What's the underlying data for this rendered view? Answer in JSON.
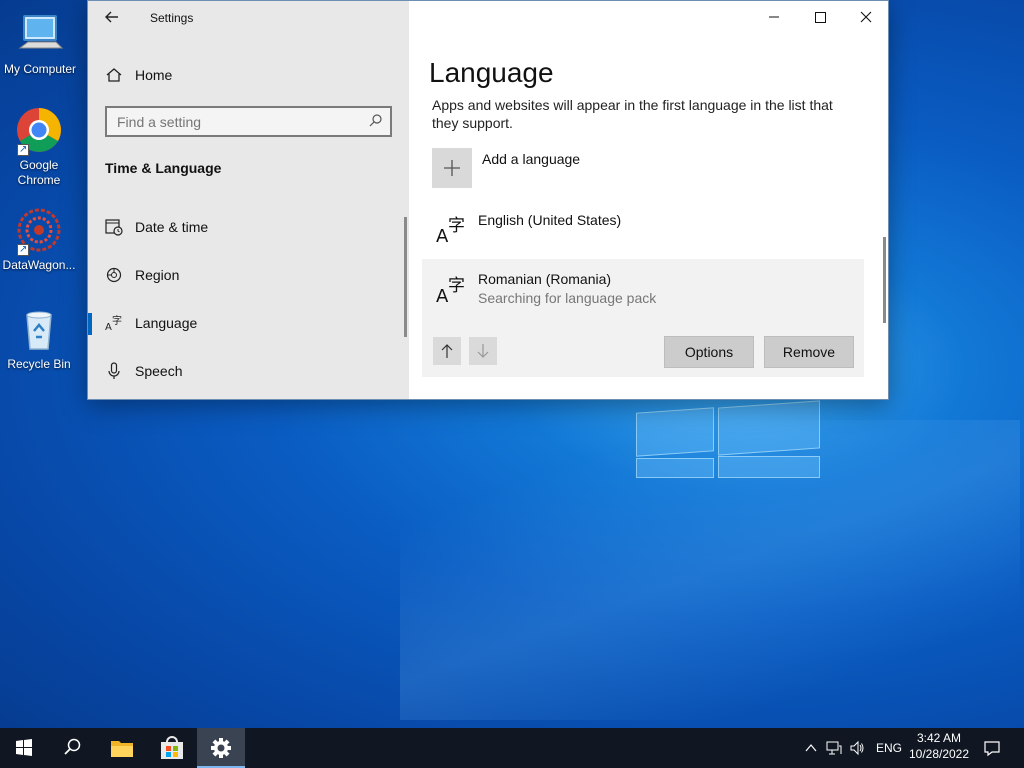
{
  "desktop": {
    "icons": [
      {
        "label": "My Computer",
        "icon": "computer-icon"
      },
      {
        "label": "Google Chrome",
        "icon": "chrome-icon"
      },
      {
        "label": "DataWagon...",
        "icon": "datawagon-icon"
      },
      {
        "label": "Recycle Bin",
        "icon": "recycle-bin-icon"
      }
    ]
  },
  "window": {
    "title": "Settings",
    "back_icon": "back-arrow-icon",
    "caption": {
      "minimize": "─",
      "maximize": "☐",
      "close": "✕"
    }
  },
  "sidebar": {
    "home_label": "Home",
    "search_placeholder": "Find a setting",
    "section_title": "Time & Language",
    "items": [
      {
        "label": "Date & time",
        "icon": "date-time-icon"
      },
      {
        "label": "Region",
        "icon": "globe-icon"
      },
      {
        "label": "Language",
        "icon": "language-icon",
        "active": true
      },
      {
        "label": "Speech",
        "icon": "microphone-icon"
      }
    ]
  },
  "main": {
    "title": "Language",
    "description": "Apps and websites will appear in the first language in the list that they support.",
    "add_label": "Add a language",
    "languages": [
      {
        "name": "English (United States)",
        "status": ""
      },
      {
        "name": "Romanian (Romania)",
        "status": "Searching for language pack",
        "selected": true
      }
    ],
    "options_label": "Options",
    "remove_label": "Remove"
  },
  "taskbar": {
    "apps": [
      "start-icon",
      "search-icon",
      "file-explorer-icon",
      "store-icon",
      "settings-icon"
    ],
    "active_app": "settings-icon",
    "language": "ENG",
    "time": "3:42 AM",
    "date": "10/28/2022"
  }
}
